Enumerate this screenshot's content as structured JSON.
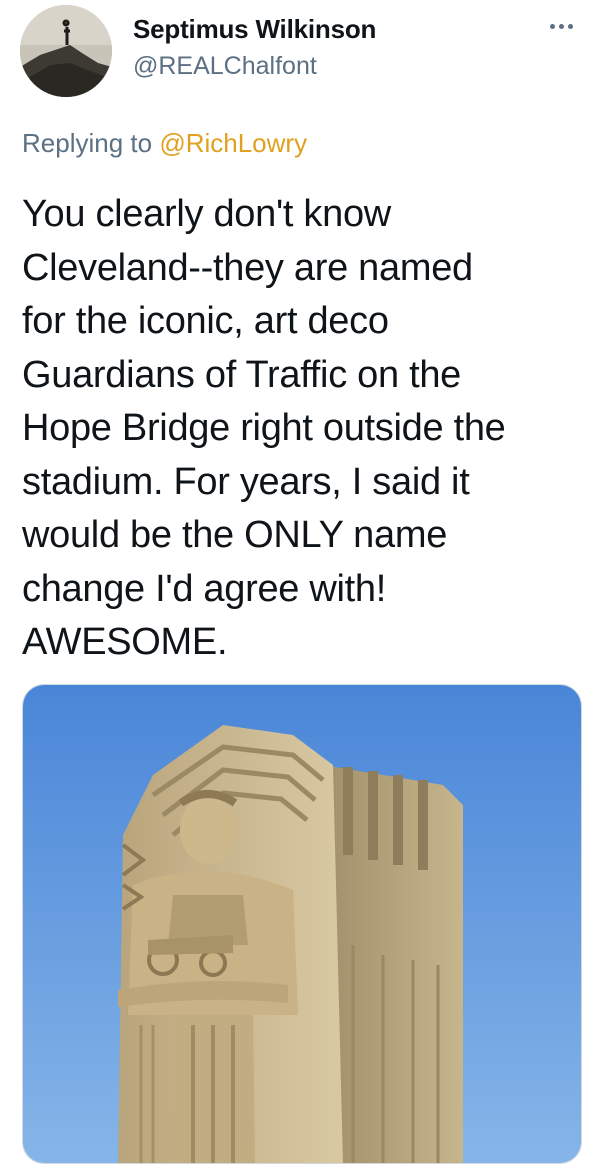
{
  "tweet": {
    "author": {
      "display_name": "Septimus Wilkinson",
      "handle": "@REALChalfont",
      "avatar_icon": "avatar-landscape-photo"
    },
    "more_icon": "more-options-icon",
    "reply_context": {
      "prefix": "Replying to",
      "mention": "@RichLowry"
    },
    "text": "You clearly don't know\nCleveland--they are named\nfor the iconic, art deco\nGuardians of Traffic on the\nHope Bridge right outside the\nstadium. For years, I said it\nwould be the ONLY name\nchange I'd agree with!\nAWESOME.",
    "media": {
      "type": "photo",
      "subject": "Guardian of Traffic statue"
    }
  },
  "colors": {
    "text_primary": "#0f1419",
    "text_secondary": "#5b7083",
    "mention": "#e0a020",
    "sky_top": "#4a86d8",
    "sky_bottom": "#7fb0e6",
    "stone": "#cbb88f"
  }
}
